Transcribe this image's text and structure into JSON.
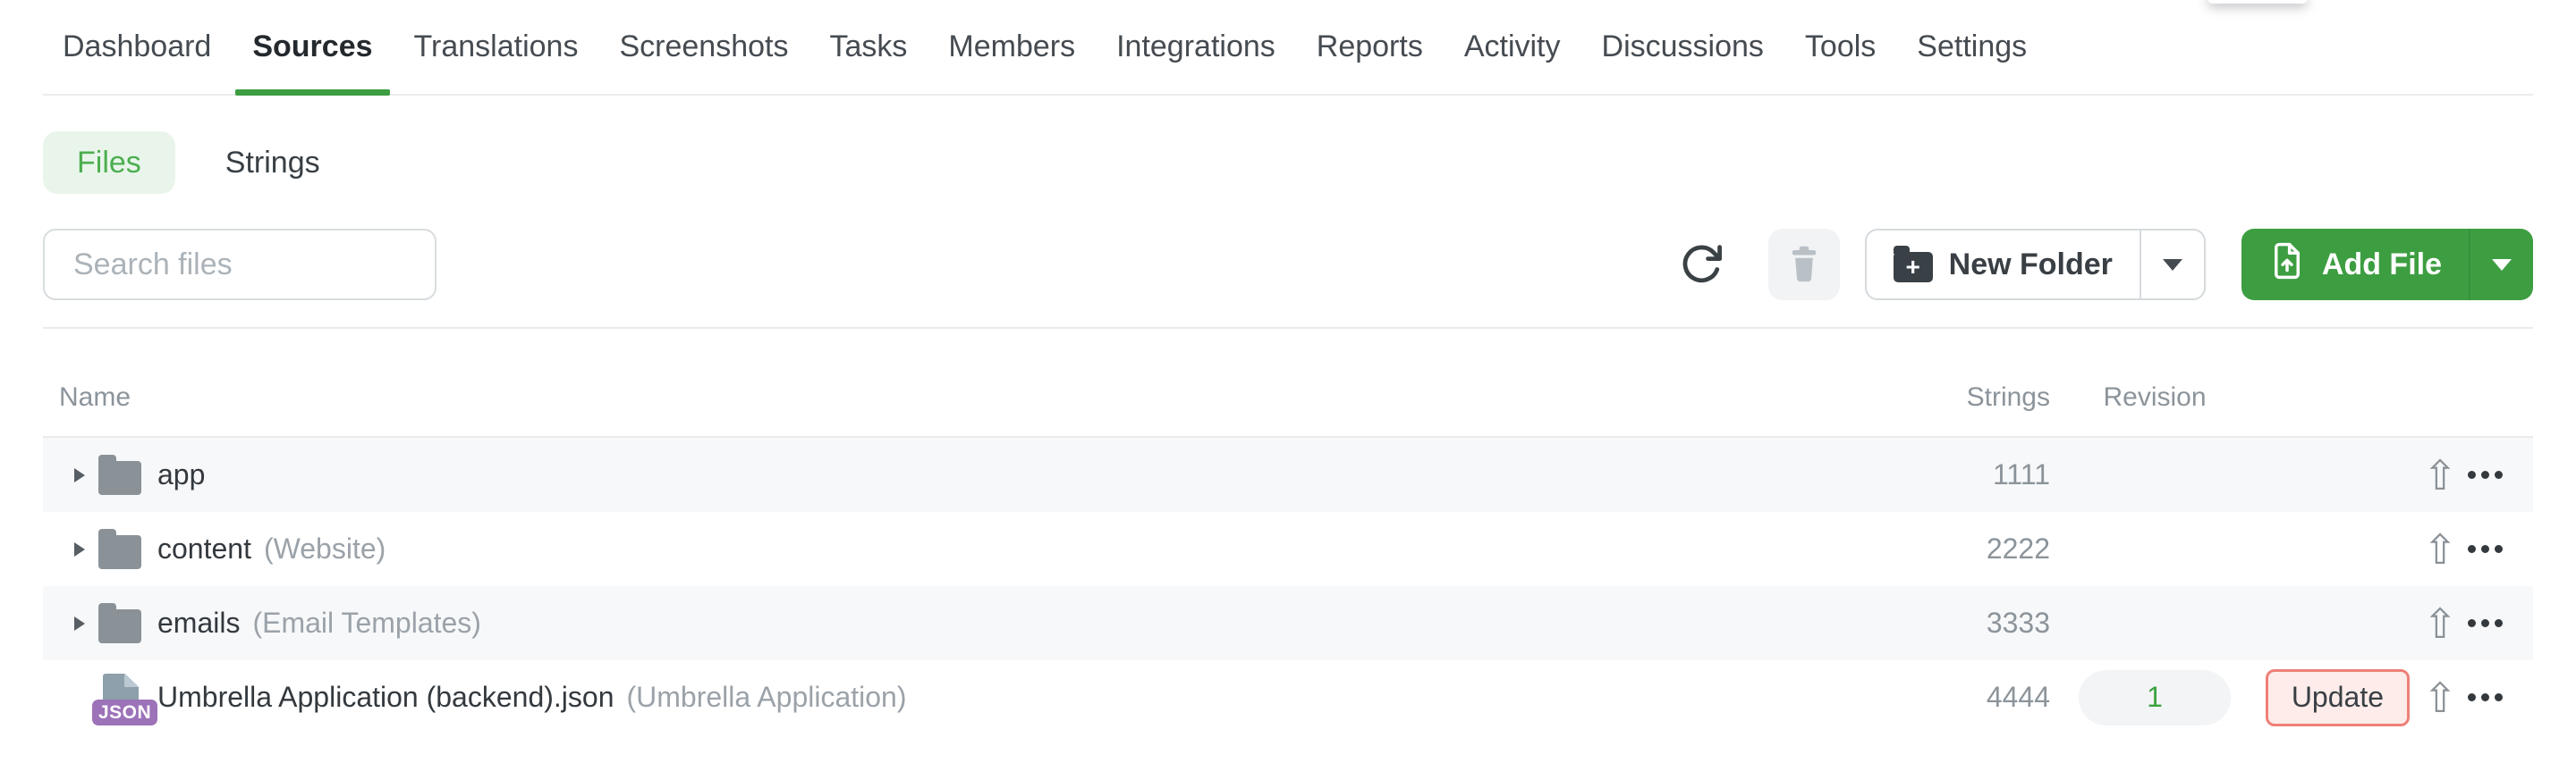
{
  "nav": {
    "items": [
      {
        "label": "Dashboard",
        "active": false
      },
      {
        "label": "Sources",
        "active": true
      },
      {
        "label": "Translations",
        "active": false
      },
      {
        "label": "Screenshots",
        "active": false
      },
      {
        "label": "Tasks",
        "active": false
      },
      {
        "label": "Members",
        "active": false
      },
      {
        "label": "Integrations",
        "active": false
      },
      {
        "label": "Reports",
        "active": false
      },
      {
        "label": "Activity",
        "active": false
      },
      {
        "label": "Discussions",
        "active": false
      },
      {
        "label": "Tools",
        "active": false
      },
      {
        "label": "Settings",
        "active": false
      }
    ]
  },
  "tabs": {
    "files_label": "Files",
    "strings_label": "Strings",
    "active": "Files"
  },
  "toolbar": {
    "search_placeholder": "Search files",
    "search_value": "",
    "new_folder_label": "New Folder",
    "add_file_label": "Add File"
  },
  "table": {
    "headers": {
      "name": "Name",
      "strings": "Strings",
      "revision": "Revision"
    },
    "rows": [
      {
        "type": "folder",
        "name": "app",
        "note": "",
        "strings": "1111",
        "revision": ""
      },
      {
        "type": "folder",
        "name": "content",
        "note": "(Website)",
        "strings": "2222",
        "revision": ""
      },
      {
        "type": "folder",
        "name": "emails",
        "note": "(Email Templates)",
        "strings": "3333",
        "revision": ""
      },
      {
        "type": "file",
        "file_badge": "JSON",
        "name": "Umbrella Application (backend).json",
        "note": "(Umbrella Application)",
        "strings": "4444",
        "revision": "1",
        "update_label": "Update"
      }
    ]
  },
  "icons": {
    "refresh": "circular-arrow-clockwise",
    "trash": "trash-can",
    "new_folder": "folder-plus",
    "add_file": "file-upload",
    "dropdown_caret": "caret-down-triangle",
    "row_expand": "caret-right-triangle",
    "upload_glyph": "⇧",
    "plus_glyph": "+",
    "more": "three-dots"
  },
  "colors": {
    "accent_green": "#3d9e41",
    "tab_pill_bg": "#e9f5ea",
    "tab_pill_text": "#4cae50",
    "update_border": "#ee8077",
    "update_bg": "#fdecea",
    "row_stripe": "#f7f8f9",
    "muted_text": "#8c949b",
    "dark_text": "#33393e",
    "json_badge": "#9c72b8",
    "file_icon": "#8da0ab",
    "folder_icon": "#8a9298",
    "revision_badge_bg": "#f2f4f6"
  }
}
